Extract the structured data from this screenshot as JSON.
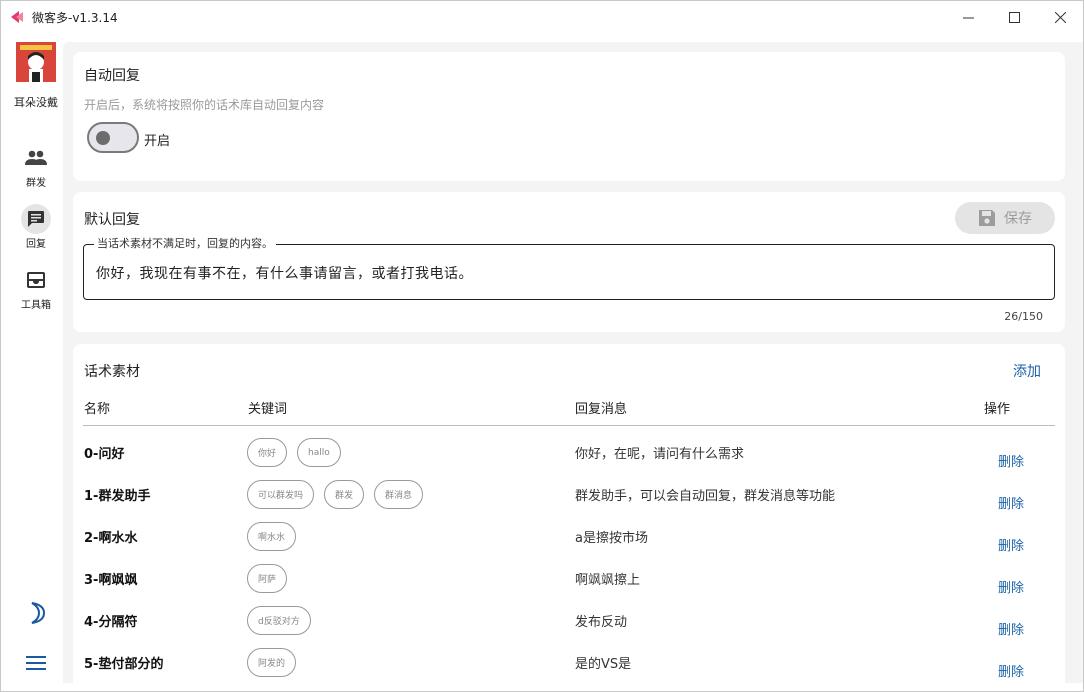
{
  "window": {
    "title": "微客多-v1.3.14",
    "controls": {
      "minimize": "—",
      "maximize": "☐",
      "close": "✕"
    }
  },
  "sidebar": {
    "username": "耳朵没戴",
    "nav": [
      {
        "label": "群发",
        "icon": "group-icon",
        "active": false
      },
      {
        "label": "回复",
        "icon": "message-icon",
        "active": true
      },
      {
        "label": "工具箱",
        "icon": "toolbox-icon",
        "active": false
      }
    ],
    "bottom": [
      "moon-icon",
      "menu-icon"
    ]
  },
  "auto_reply": {
    "title": "自动回复",
    "description": "开启后，系统将按照你的话术库自动回复内容",
    "toggle_label": "开启",
    "enabled": false
  },
  "default_reply": {
    "title": "默认回复",
    "save_label": "保存",
    "field_label": "当话术素材不满足时，回复的内容。",
    "field_value": "你好，我现在有事不在，有什么事请留言，或者打我电话。",
    "counter": "26/150"
  },
  "scripts": {
    "title": "话术素材",
    "add_label": "添加",
    "columns": {
      "name": "名称",
      "keywords": "关键词",
      "reply": "回复消息",
      "action": "操作"
    },
    "rows": [
      {
        "name": "0-问好",
        "tags": [
          "你好",
          "hallo"
        ],
        "reply": "你好，在呢，请问有什么需求",
        "action": "删除"
      },
      {
        "name": "1-群发助手",
        "tags": [
          "可以群发吗",
          "群发",
          "群消息"
        ],
        "reply": "群发助手，可以会自动回复，群发消息等功能",
        "action": "删除"
      },
      {
        "name": "2-啊水水",
        "tags": [
          "啊水水"
        ],
        "reply": "a是擦按市场",
        "action": "删除"
      },
      {
        "name": "3-啊飒飒",
        "tags": [
          "阿萨"
        ],
        "reply": "啊飒飒擦上",
        "action": "删除"
      },
      {
        "name": "4-分隔符",
        "tags": [
          "d反驳对方"
        ],
        "reply": "发布反动",
        "action": "删除"
      },
      {
        "name": "5-垫付部分的",
        "tags": [
          "阿发的"
        ],
        "reply": "是的VS是",
        "action": "删除"
      }
    ]
  },
  "colors": {
    "accent": "#1a62a8",
    "background": "#f4f4f4",
    "card": "#ffffff"
  }
}
